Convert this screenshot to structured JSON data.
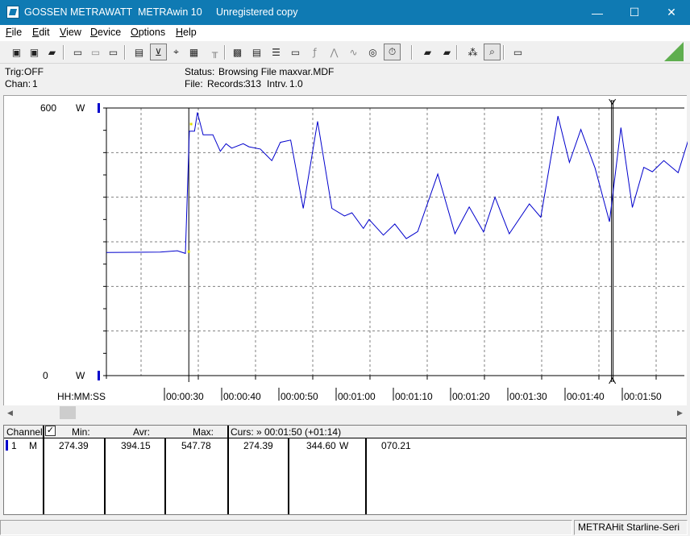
{
  "window": {
    "company": "GOSSEN METRAWATT",
    "app": "METRAwin 10",
    "license": "Unregistered copy",
    "controls": {
      "minimize": "—",
      "maximize": "☐",
      "close": "✕"
    }
  },
  "menu": [
    {
      "mnemonic": "F",
      "rest": "ile"
    },
    {
      "mnemonic": "E",
      "rest": "dit"
    },
    {
      "mnemonic": "V",
      "rest": "iew"
    },
    {
      "mnemonic": "D",
      "rest": "evice"
    },
    {
      "mnemonic": "O",
      "rest": "ptions"
    },
    {
      "mnemonic": "H",
      "rest": "elp"
    }
  ],
  "toolbar": {
    "icons": [
      "new-file-icon",
      "save-icon",
      "open-folder-icon",
      "device-read-icon",
      "device-stop-icon",
      "device-config-icon",
      "keyboard-icon",
      "zoom-waveform-icon",
      "crosshair-icon",
      "grid-icon",
      "histogram-icon",
      "copy-window-icon",
      "export-table-icon",
      "list-icon",
      "monitor-icon",
      "formula-icon",
      "spike-icon",
      "waveform-icon",
      "record-icon",
      "stopwatch-icon",
      "printer-icon",
      "print-preview-icon",
      "zoom-signal-icon",
      "zoom-cursor-icon",
      "comment-icon"
    ],
    "glyphs": [
      "▣",
      "▣",
      "▰",
      "▭",
      "▭",
      "▭",
      "▤",
      "⊻",
      "⌖",
      "▦",
      "╥",
      "▩",
      "▤",
      "☰",
      "▭",
      "ƒ",
      "⋀",
      "∿",
      "◎",
      "⏱",
      "▰",
      "▰",
      "⁂",
      "⌕",
      "▭"
    ]
  },
  "status": {
    "trig_label": "Trig:",
    "trig_value": "OFF",
    "chan_label": "Chan:",
    "chan_value": "1",
    "status_label": "Status:",
    "status_value": "Browsing File maxvar.MDF",
    "file_label": "File:",
    "records_label": "Records:",
    "records_value": "313",
    "intrv_label": "Intrv.",
    "intrv_value": "1.0"
  },
  "chart_data": {
    "type": "line",
    "y_unit": "W",
    "ylim": [
      0,
      600
    ],
    "y_top_label": "600",
    "y_bottom_label": "0",
    "x_axis_label": "HH:MM:SS",
    "x_ticks": [
      "00:00:30",
      "00:00:40",
      "00:00:50",
      "00:01:00",
      "00:01:10",
      "00:01:20",
      "00:01:30",
      "00:01:40",
      "00:01:50"
    ],
    "x_range_seconds": [
      20.6,
      116
    ],
    "grid": true,
    "series": [
      {
        "color": "#0000cc",
        "points": [
          [
            20.6,
            276
          ],
          [
            30,
            277
          ],
          [
            33,
            280
          ],
          [
            34.4,
            274
          ],
          [
            35.1,
            548
          ],
          [
            36,
            548
          ],
          [
            36.5,
            590
          ],
          [
            37.5,
            540
          ],
          [
            39.2,
            540
          ],
          [
            40.5,
            503
          ],
          [
            41.5,
            520
          ],
          [
            42.5,
            510
          ],
          [
            44.5,
            520
          ],
          [
            45.5,
            513
          ],
          [
            47.5,
            508
          ],
          [
            48.5,
            495
          ],
          [
            49.5,
            482
          ],
          [
            50,
            495
          ],
          [
            51,
            523
          ],
          [
            52.8,
            528
          ],
          [
            55,
            375
          ],
          [
            57.5,
            570
          ],
          [
            60,
            375
          ],
          [
            62.2,
            358
          ],
          [
            63.5,
            365
          ],
          [
            65.5,
            330
          ],
          [
            66.5,
            350
          ],
          [
            69,
            315
          ],
          [
            71,
            340
          ],
          [
            73,
            307
          ],
          [
            75,
            323
          ],
          [
            78.5,
            452
          ],
          [
            81.5,
            318
          ],
          [
            84,
            378
          ],
          [
            86.5,
            322
          ],
          [
            88.5,
            400
          ],
          [
            91,
            318
          ],
          [
            94.5,
            385
          ],
          [
            96.5,
            355
          ],
          [
            99.5,
            582
          ],
          [
            101.5,
            478
          ],
          [
            103.5,
            552
          ],
          [
            106,
            465
          ],
          [
            108.5,
            345
          ],
          [
            110.5,
            556
          ],
          [
            112.5,
            377
          ],
          [
            114.5,
            467
          ],
          [
            116,
            457
          ],
          [
            118,
            482
          ],
          [
            120.5,
            455
          ],
          [
            123,
            558
          ],
          [
            125.5,
            378
          ],
          [
            128,
            533
          ],
          [
            131,
            347
          ],
          [
            132.5,
            508
          ],
          [
            135,
            387
          ],
          [
            137.5,
            508
          ],
          [
            140.5,
            358
          ],
          [
            142.5,
            485
          ],
          [
            145.5,
            358
          ],
          [
            147.5,
            378
          ],
          [
            151,
            558
          ],
          [
            153.5,
            347
          ],
          [
            156,
            430
          ],
          [
            158.5,
            318
          ],
          [
            161,
            458
          ],
          [
            163.5,
            305
          ],
          [
            166,
            405
          ],
          [
            167.5,
            387
          ],
          [
            170.5,
            430
          ],
          [
            172.5,
            383
          ],
          [
            175,
            447
          ],
          [
            177.5,
            358
          ],
          [
            179.5,
            435
          ],
          [
            182.5,
            358
          ],
          [
            184.5,
            425
          ],
          [
            186,
            455
          ],
          [
            188,
            367
          ],
          [
            190.5,
            445
          ],
          [
            192,
            432
          ]
        ],
        "markers": [
          {
            "x": 35,
            "y": 278,
            "color": "#e0e000"
          },
          {
            "x": 35.4,
            "y": 564,
            "color": "#e0e000"
          }
        ]
      }
    ],
    "cursors": [
      {
        "x": 35.0
      },
      {
        "x": 109
      }
    ]
  },
  "scrollbar": {
    "left": "◀",
    "right": "▶"
  },
  "table": {
    "headers": {
      "channel": "Channel:",
      "check": "✓",
      "min": "Min:",
      "avr": "Avr:",
      "max": "Max:",
      "curs": "Curs: » 00:01:50 (+01:14)"
    },
    "rows": [
      {
        "channel": "1",
        "mode": "M",
        "min": "274.39",
        "avr": "394.15",
        "max": "547.78",
        "curs_min": "274.39",
        "curs_val": "344.60",
        "unit": "W",
        "extra": "070.21"
      }
    ]
  },
  "statusbar": {
    "device": "METRAHit Starline-Seri"
  }
}
